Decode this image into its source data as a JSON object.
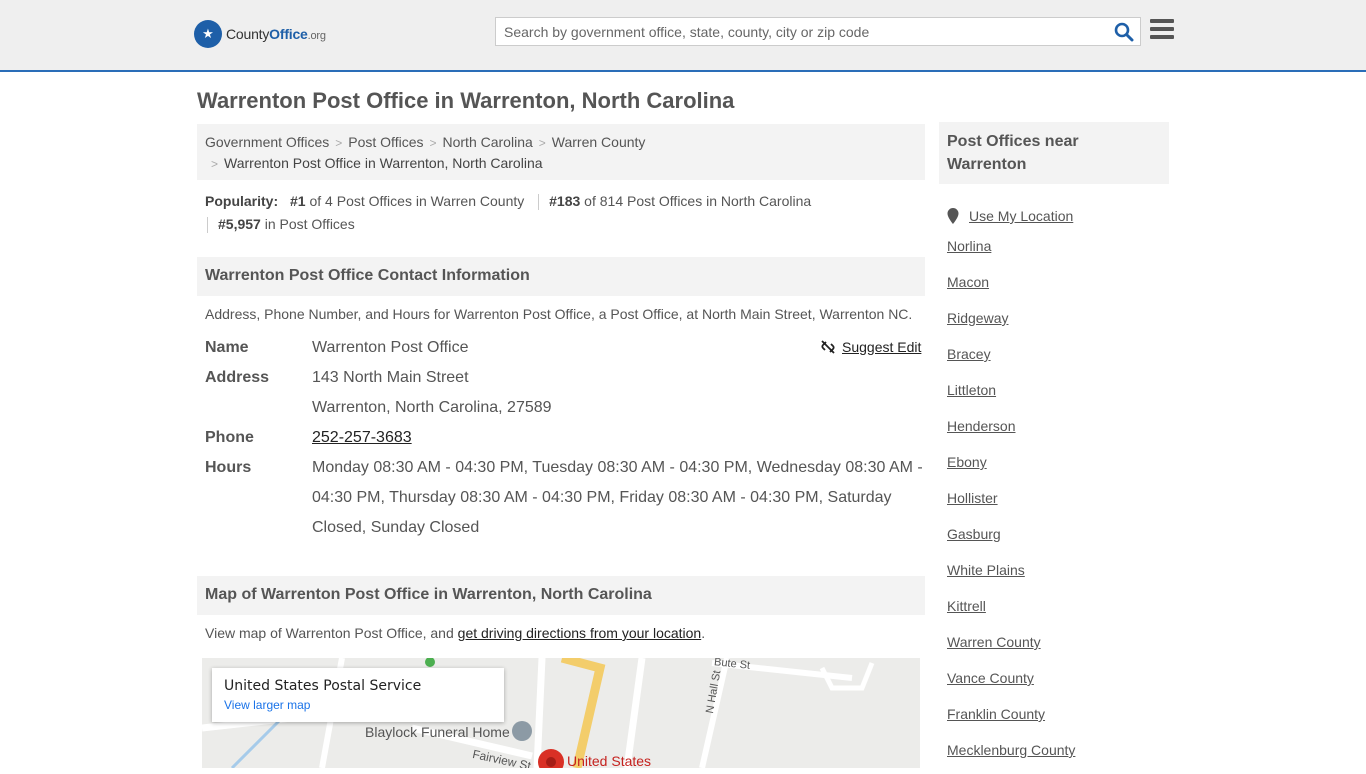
{
  "header": {
    "logo_main": "County",
    "logo_accent": "Office",
    "logo_suffix": ".org",
    "search_placeholder": "Search by government office, state, county, city or zip code"
  },
  "page_title": "Warrenton Post Office in Warrenton, North Carolina",
  "breadcrumb": {
    "items": [
      "Government Offices",
      "Post Offices",
      "North Carolina",
      "Warren County"
    ],
    "current": "Warrenton Post Office in Warrenton, North Carolina"
  },
  "popularity": {
    "label": "Popularity:",
    "rank1": "#1",
    "rank1_text": " of 4 Post Offices in Warren County",
    "rank2": "#183",
    "rank2_text": " of 814 Post Offices in North Carolina",
    "rank3": "#5,957",
    "rank3_text": " in Post Offices"
  },
  "contact": {
    "heading": "Warrenton Post Office Contact Information",
    "description": "Address, Phone Number, and Hours for Warrenton Post Office, a Post Office, at North Main Street, Warrenton NC.",
    "suggest_edit": "Suggest Edit",
    "name_label": "Name",
    "name": "Warrenton Post Office",
    "address_label": "Address",
    "address_line1": "143 North Main Street",
    "address_line2": "Warrenton, North Carolina, 27589",
    "phone_label": "Phone",
    "phone": "252-257-3683",
    "hours_label": "Hours",
    "hours": "Monday 08:30 AM - 04:30 PM, Tuesday 08:30 AM - 04:30 PM, Wednesday 08:30 AM - 04:30 PM, Thursday 08:30 AM - 04:30 PM, Friday 08:30 AM - 04:30 PM, Saturday Closed, Sunday Closed"
  },
  "map": {
    "heading": "Map of Warrenton Post Office in Warrenton, North Carolina",
    "desc_prefix": "View map of Warrenton Post Office, and ",
    "directions_link": "get driving directions from your location",
    "desc_suffix": ".",
    "card_title": "United States Postal Service",
    "card_link": "View larger map",
    "label_funeral": "Blaylock Funeral Home",
    "label_fairview": "Fairview St",
    "label_hall": "N Hall St",
    "label_bute": "Bute St",
    "label_us": "United States"
  },
  "sidebar": {
    "heading": "Post Offices near Warrenton",
    "use_location": "Use My Location",
    "items": [
      "Norlina",
      "Macon",
      "Ridgeway",
      "Bracey",
      "Littleton",
      "Henderson",
      "Ebony",
      "Hollister",
      "Gasburg",
      "White Plains",
      "Kittrell",
      "Warren County",
      "Vance County",
      "Franklin County",
      "Mecklenburg County"
    ]
  }
}
